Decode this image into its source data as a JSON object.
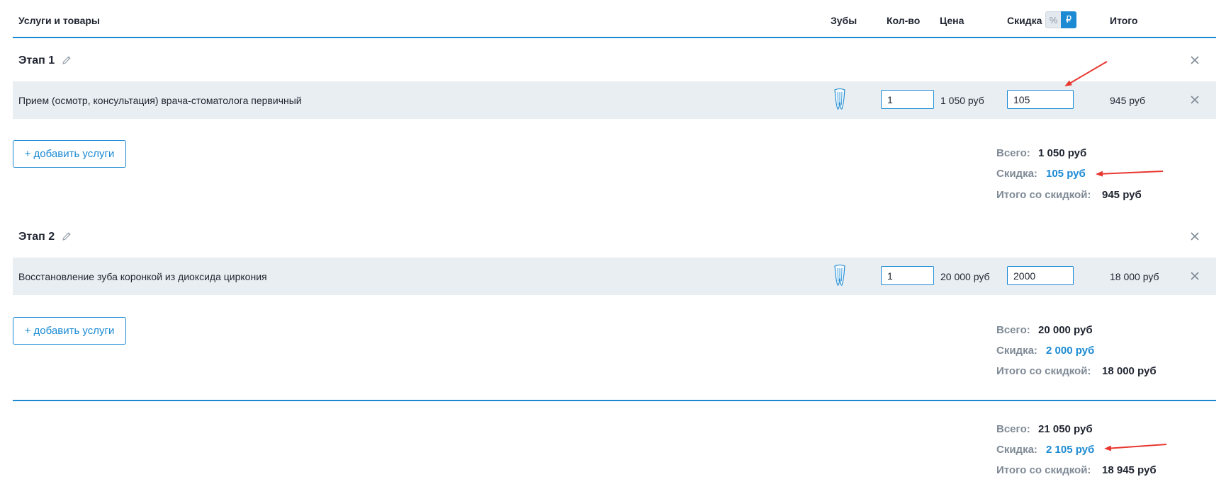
{
  "header": {
    "services": "Услуги и товары",
    "teeth": "Зубы",
    "qty": "Кол-во",
    "price": "Цена",
    "discount": "Скидка",
    "pct_symbol": "%",
    "rub_symbol": "₽",
    "total": "Итого",
    "active_mode": "₽"
  },
  "stages": [
    {
      "title": "Этап 1",
      "service": "Прием (осмотр, консультация) врача-стоматолога первичный",
      "qty": "1",
      "price": "1 050 руб",
      "discount": "105",
      "total": "945 руб",
      "add_label": "+ добавить услуги",
      "summary": {
        "all_label": "Всего:",
        "all_value": "1 050 руб",
        "disc_label": "Скидка:",
        "disc_value": "105 руб",
        "final_label": "Итого со скидкой:",
        "final_value": "945 руб"
      }
    },
    {
      "title": "Этап 2",
      "service": "Восстановление зуба коронкой из диоксида циркония",
      "qty": "1",
      "price": "20 000 руб",
      "discount": "2000",
      "total": "18 000 руб",
      "add_label": "+ добавить услуги",
      "summary": {
        "all_label": "Всего:",
        "all_value": "20 000 руб",
        "disc_label": "Скидка:",
        "disc_value": "2 000 руб",
        "final_label": "Итого со скидкой:",
        "final_value": "18 000 руб"
      }
    }
  ],
  "grand": {
    "all_label": "Всего:",
    "all_value": "21 050 руб",
    "disc_label": "Скидка:",
    "disc_value": "2 105 руб",
    "final_label": "Итого со скидкой:",
    "final_value": "18 945 руб"
  },
  "colors": {
    "accent": "#1b8ad3",
    "annotation_arrow": "#e8372f",
    "row_bg": "#e9eef2"
  },
  "icons": {
    "edit": "pencil-icon",
    "remove": "close-icon",
    "tooth": "tooth-icon"
  }
}
